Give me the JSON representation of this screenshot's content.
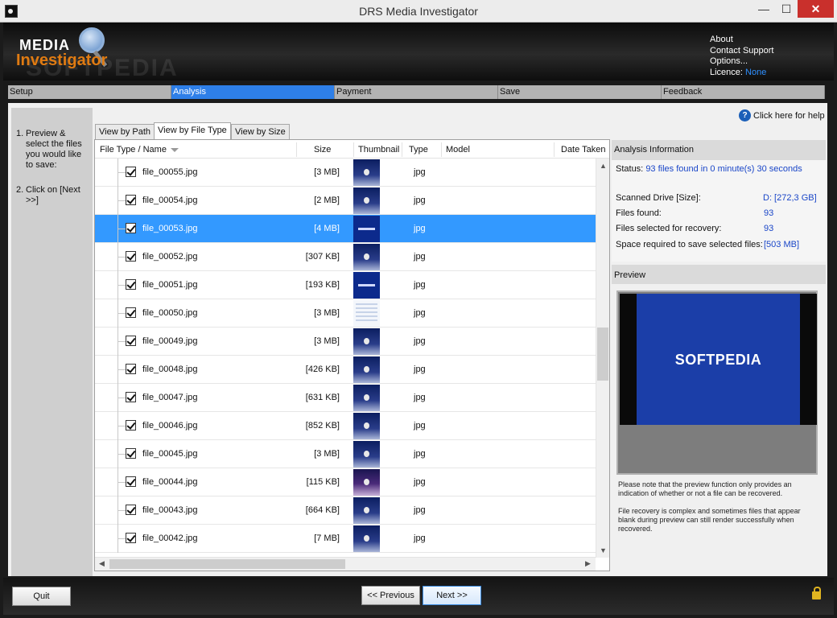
{
  "window": {
    "title": "DRS Media Investigator"
  },
  "header": {
    "logo_line1": "MEDIA",
    "logo_line2": "Investigator",
    "watermark": "SOFTPEDIA",
    "links": {
      "about": "About",
      "contact": "Contact Support",
      "options": "Options...",
      "licence_label": "Licence:",
      "licence_value": "None"
    }
  },
  "steps": [
    "Setup",
    "Analysis",
    "Payment",
    "Save",
    "Feedback"
  ],
  "active_step": "Analysis",
  "instructions": [
    {
      "num": "1.",
      "text": "Preview & select the files you would like to save:"
    },
    {
      "num": "2.",
      "text": "Click on [Next >>]"
    }
  ],
  "help_text": "Click here for help",
  "view_tabs": [
    "View by Path",
    "View by File Type",
    "View by Size"
  ],
  "active_view_tab": "View by File Type",
  "columns": {
    "name": "File Type / Name",
    "size": "Size",
    "thumbnail": "Thumbnail",
    "type": "Type",
    "model": "Model",
    "date": "Date Taken"
  },
  "files": [
    {
      "name": "file_00055.jpg",
      "size": "[3 MB]",
      "type": "jpg",
      "thumb": "star",
      "checked": true
    },
    {
      "name": "file_00054.jpg",
      "size": "[2 MB]",
      "type": "jpg",
      "thumb": "star",
      "checked": true
    },
    {
      "name": "file_00053.jpg",
      "size": "[4 MB]",
      "type": "jpg",
      "thumb": "logo",
      "checked": true,
      "selected": true
    },
    {
      "name": "file_00052.jpg",
      "size": "[307 KB]",
      "type": "jpg",
      "thumb": "star",
      "checked": true
    },
    {
      "name": "file_00051.jpg",
      "size": "[193 KB]",
      "type": "jpg",
      "thumb": "logo",
      "checked": true
    },
    {
      "name": "file_00050.jpg",
      "size": "[3 MB]",
      "type": "jpg",
      "thumb": "shot",
      "checked": true
    },
    {
      "name": "file_00049.jpg",
      "size": "[3 MB]",
      "type": "jpg",
      "thumb": "star",
      "checked": true
    },
    {
      "name": "file_00048.jpg",
      "size": "[426 KB]",
      "type": "jpg",
      "thumb": "star",
      "checked": true
    },
    {
      "name": "file_00047.jpg",
      "size": "[631 KB]",
      "type": "jpg",
      "thumb": "star",
      "checked": true
    },
    {
      "name": "file_00046.jpg",
      "size": "[852 KB]",
      "type": "jpg",
      "thumb": "star",
      "checked": true
    },
    {
      "name": "file_00045.jpg",
      "size": "[3 MB]",
      "type": "jpg",
      "thumb": "star",
      "checked": true
    },
    {
      "name": "file_00044.jpg",
      "size": "[115 KB]",
      "type": "jpg",
      "thumb": "purple",
      "checked": true
    },
    {
      "name": "file_00043.jpg",
      "size": "[664 KB]",
      "type": "jpg",
      "thumb": "star",
      "checked": true
    },
    {
      "name": "file_00042.jpg",
      "size": "[7 MB]",
      "type": "jpg",
      "thumb": "star",
      "checked": true
    }
  ],
  "analysis": {
    "title": "Analysis Information",
    "status_label": "Status:",
    "status_value": "93 files found in 0 minute(s) 30 seconds",
    "rows": [
      {
        "label": "Scanned Drive [Size]:",
        "value": "D:  [272,3 GB]"
      },
      {
        "label": "Files found:",
        "value": "93"
      },
      {
        "label": "Files selected for recovery:",
        "value": "93"
      },
      {
        "label": "Space required to save selected files:",
        "value": "[503 MB]"
      }
    ]
  },
  "preview": {
    "title": "Preview",
    "image_text": "SOFTPEDIA",
    "note1": "Please note that the preview function only provides an indication of whether or not a file can be recovered.",
    "note2": "File recovery is complex and sometimes files that appear blank during preview can still render successfully when recovered."
  },
  "buttons": {
    "quit": "Quit",
    "previous": "<< Previous",
    "next": "Next >>"
  },
  "colors": {
    "accent": "#3399ff",
    "step_active": "#2e7fe8",
    "logo_orange": "#e07b12",
    "link_blue": "#1a46c8"
  }
}
